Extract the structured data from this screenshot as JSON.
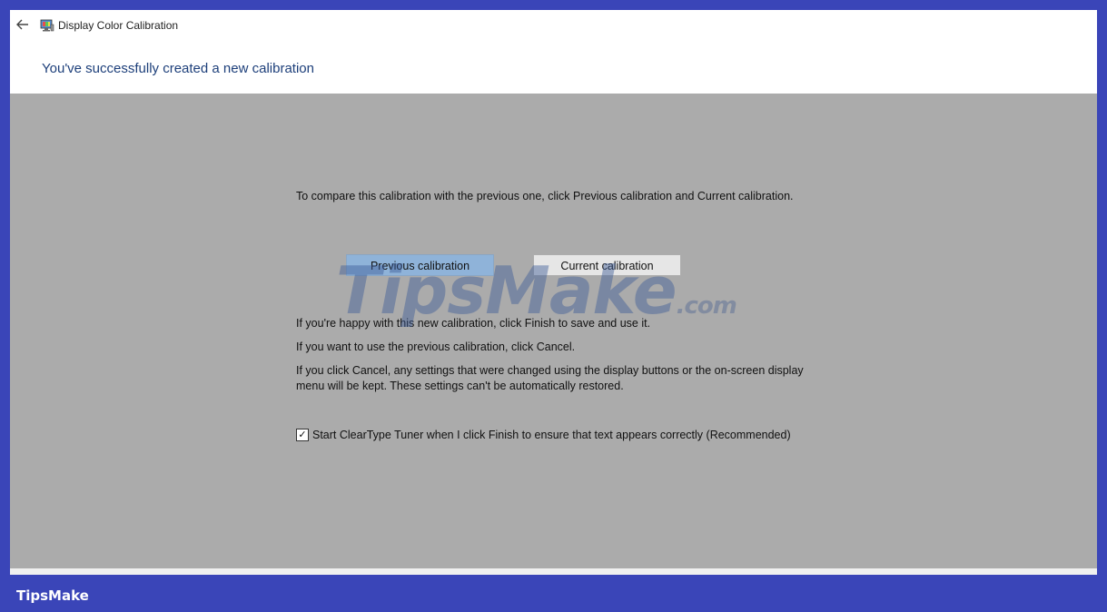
{
  "window": {
    "title": "Display Color Calibration",
    "back_icon": "arrow-left-icon",
    "app_icon": "display-calibration-icon"
  },
  "heading": "You've successfully created a new calibration",
  "content": {
    "compare_text": "To compare this calibration with the previous one, click Previous calibration and Current calibration.",
    "buttons": {
      "previous": "Previous calibration",
      "current": "Current calibration"
    },
    "happy_text": "If you're happy with this new calibration, click Finish to save and use it.",
    "previous_text": "If you want to use the previous calibration, click Cancel.",
    "cancel_text": "If you click Cancel, any settings that were changed using the display buttons or the on-screen display menu will be kept. These settings can't be automatically restored.",
    "cleartype_checkbox": {
      "label": "Start ClearType Tuner when I click Finish to ensure that text appears correctly (Recommended)",
      "checked": true
    }
  },
  "watermark": {
    "main": "TipsMake",
    "suffix": ".com"
  },
  "footer_brand": "TipsMake",
  "colors": {
    "frame": "#3a45b8",
    "content_bg": "#ababab",
    "heading": "#1d3f7a",
    "selected_button": "#8fb3d9"
  }
}
